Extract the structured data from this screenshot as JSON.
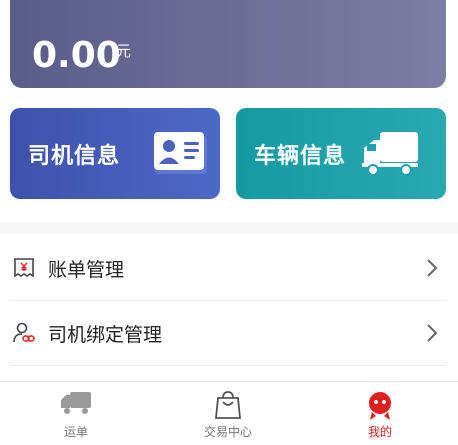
{
  "balance": {
    "amount": "0.00",
    "unit": "元"
  },
  "cards": {
    "driver_info": {
      "label": "司机信息",
      "icon": "id-card-icon"
    },
    "vehicle_info": {
      "label": "车辆信息",
      "icon": "truck-icon"
    }
  },
  "menu": [
    {
      "label": "账单管理",
      "icon": "bill-icon"
    },
    {
      "label": "司机绑定管理",
      "icon": "driver-bind-icon"
    }
  ],
  "nav": [
    {
      "label": "运单",
      "icon": "truck-icon",
      "active": false
    },
    {
      "label": "交易中心",
      "icon": "shopping-bag-icon",
      "active": false
    },
    {
      "label": "我的",
      "icon": "profile-icon",
      "active": true
    }
  ],
  "colors": {
    "balance_card": "#6a6c96",
    "driver_card": "#4559b8",
    "vehicle_card": "#1fa1ab",
    "active_nav": "#e02020"
  }
}
